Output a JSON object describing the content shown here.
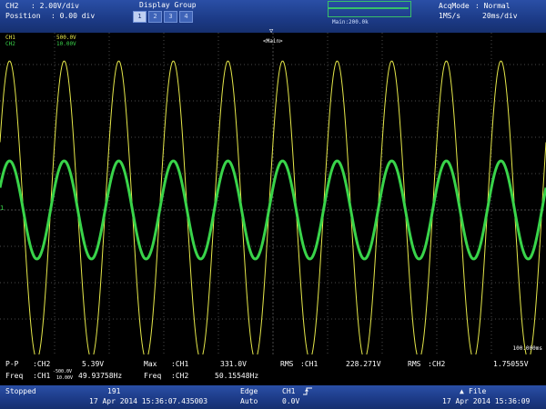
{
  "top": {
    "ch_label": "CH2",
    "ch_scale": ": 2.00V/div",
    "position_label": "Position",
    "position_value": ": 0.00 div",
    "display_group_title": "Display Group",
    "display_groups": [
      "1",
      "2",
      "3",
      "4"
    ],
    "zoom_main": "Main:200.0k",
    "acq_label": "AcqMode",
    "acq_value": ": Normal",
    "sample_rate": "1MS/s",
    "timebase": "20ms/div"
  },
  "screen": {
    "ch1_tag": "CH1",
    "ch1_scale": "500.0V",
    "ch2_tag": "CH2",
    "ch2_scale": "10.00V",
    "trigger_marker": "▽",
    "main_label": "<Main>",
    "h_scale": "100.000ms",
    "left_marker": "1"
  },
  "measurements": {
    "row1": [
      {
        "label": "P-P",
        "src": ":CH2",
        "value": "5.39V"
      },
      {
        "label": "Max",
        "src": ":CH1",
        "value": "331.0V"
      },
      {
        "label": "RMS",
        "src": ":CH1",
        "value": "228.271V"
      },
      {
        "label": "RMS",
        "src": ":CH2",
        "value": "1.75055V"
      }
    ],
    "row2": [
      {
        "label": "Freq",
        "src": ":CH1",
        "value": "49.93758Hz"
      },
      {
        "label": "Freq",
        "src": ":CH2",
        "value": "50.15548Hz"
      }
    ],
    "overlay_ch1": "-500.0V",
    "overlay_ch2": "10.00V"
  },
  "status": {
    "state": "Stopped",
    "acq_count": "191",
    "acq_time": "17 Apr 2014 15:36:07.435003",
    "trigger_label": "Edge",
    "trigger_mode": "Auto",
    "trigger_source": "CH1",
    "trigger_slope_icon": "rising-edge-icon",
    "trigger_level": "0.0V",
    "file_label": "File",
    "file_time": "17 Apr 2014 15:36:09"
  },
  "waveforms": {
    "cycles": 10,
    "ch1_color": "#e6e84a",
    "ch2_color": "#39d44a",
    "ch1_amplitude_div": 4.1,
    "ch2_amplitude_div": 1.35
  },
  "colors": {
    "bar_blue": "#1c3a86",
    "grid": "#4a4a4a",
    "zoom_green": "#38c06a"
  }
}
